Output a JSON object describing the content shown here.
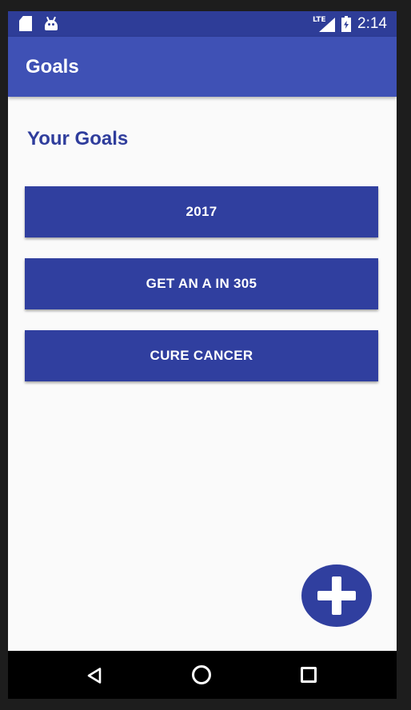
{
  "status_bar": {
    "left_icons": [
      "sd-card-icon",
      "android-icon"
    ],
    "network": "LTE",
    "time": "2:14"
  },
  "app_bar": {
    "title": "Goals"
  },
  "main": {
    "section_title": "Your Goals",
    "goals": [
      {
        "label": "2017"
      },
      {
        "label": "GET AN A IN 305"
      },
      {
        "label": "CURE CANCER"
      }
    ],
    "fab_icon": "plus-icon"
  },
  "nav_bar": {
    "buttons": [
      "back-icon",
      "home-icon",
      "recent-apps-icon"
    ]
  },
  "colors": {
    "primary": "#3f51b5",
    "primary_dark": "#303f9f",
    "status_bar": "#2e3d98",
    "title_text": "#2f3d9c",
    "background": "#fafafa"
  }
}
